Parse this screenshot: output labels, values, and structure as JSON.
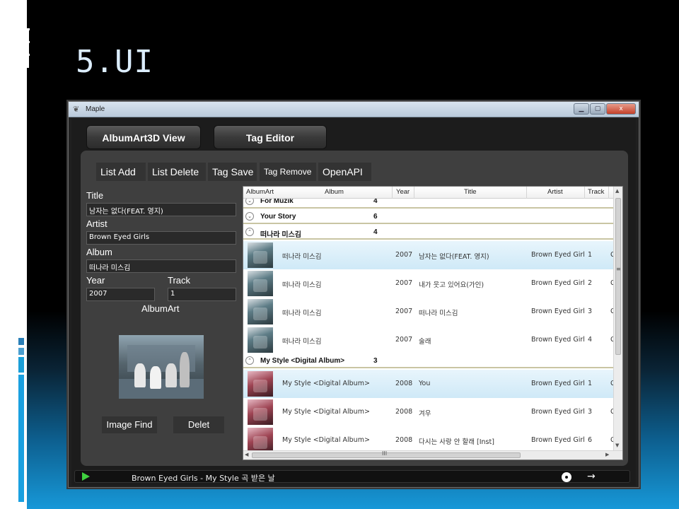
{
  "slide": {
    "title": "5.UI"
  },
  "window": {
    "title": "Maple",
    "controls": {
      "minimize": "▁",
      "maximize": "▢",
      "close": "x"
    }
  },
  "tabs": [
    {
      "label": "AlbumArt3D View"
    },
    {
      "label": "Tag Editor"
    }
  ],
  "toolbar": {
    "list_add": "List Add",
    "list_delete": "List Delete",
    "tag_save": "Tag Save",
    "tag_remove": "Tag Remove",
    "open_api": "OpenAPI"
  },
  "form": {
    "title_label": "Title",
    "title_value": "남자는 없다(FEAT. 영지)",
    "artist_label": "Artist",
    "artist_value": "Brown Eyed Girls",
    "album_label": "Album",
    "album_value": "떠나라 미스김",
    "year_label": "Year",
    "year_value": "2007",
    "track_label": "Track",
    "track_value": "1",
    "albumart_label": "AlbumArt",
    "image_find": "Image Find",
    "delet": "Delet"
  },
  "grid": {
    "columns": [
      "AlbumArt",
      "Album",
      "Year",
      "Title",
      "Artist",
      "Track"
    ],
    "groups": [
      {
        "name": "For Muzik",
        "count": "4",
        "expanded": false,
        "rows": []
      },
      {
        "name": "Your Story",
        "count": "6",
        "expanded": false,
        "rows": []
      },
      {
        "name": "떠나라 미스김",
        "count": "4",
        "expanded": true,
        "rows": [
          {
            "album": "떠나라 미스김",
            "year": "2007",
            "title": "남자는 없다(FEAT. 영지)",
            "artist": "Brown Eyed Girl",
            "track": "1",
            "extra": "C",
            "selected": true
          },
          {
            "album": "떠나라 미스김",
            "year": "2007",
            "title": "내가 웃고 있어요(가인)",
            "artist": "Brown Eyed Girl",
            "track": "2",
            "extra": "C",
            "selected": false
          },
          {
            "album": "떠나라 미스김",
            "year": "2007",
            "title": "떠나라 미스김",
            "artist": "Brown Eyed Girl",
            "track": "3",
            "extra": "C",
            "selected": false
          },
          {
            "album": "떠나라 미스김",
            "year": "2007",
            "title": "술래",
            "artist": "Brown Eyed Girl",
            "track": "4",
            "extra": "C",
            "selected": false
          }
        ]
      },
      {
        "name": "My Style <Digital Album>",
        "count": "3",
        "expanded": true,
        "rows": [
          {
            "album": "My Style <Digital Album>",
            "year": "2008",
            "title": "You",
            "artist": "Brown Eyed Girl",
            "track": "1",
            "extra": "C",
            "selected": true
          },
          {
            "album": "My Style <Digital Album>",
            "year": "2008",
            "title": "겨우",
            "artist": "Brown Eyed Girl",
            "track": "3",
            "extra": "C",
            "selected": false
          },
          {
            "album": "My Style <Digital Album>",
            "year": "2008",
            "title": "다시는 사랑 안 할래 [Inst]",
            "artist": "Brown Eyed Girl",
            "track": "6",
            "extra": "C",
            "selected": false
          }
        ]
      }
    ],
    "hscroll_grip": "III"
  },
  "player": {
    "now_playing": "Brown Eyed Girls - My Style 곡 받은 날",
    "next_glyph": "→"
  },
  "colors": {
    "accent": "#1798d8",
    "play": "#3fd13f",
    "selection": "#cfe9f7"
  }
}
